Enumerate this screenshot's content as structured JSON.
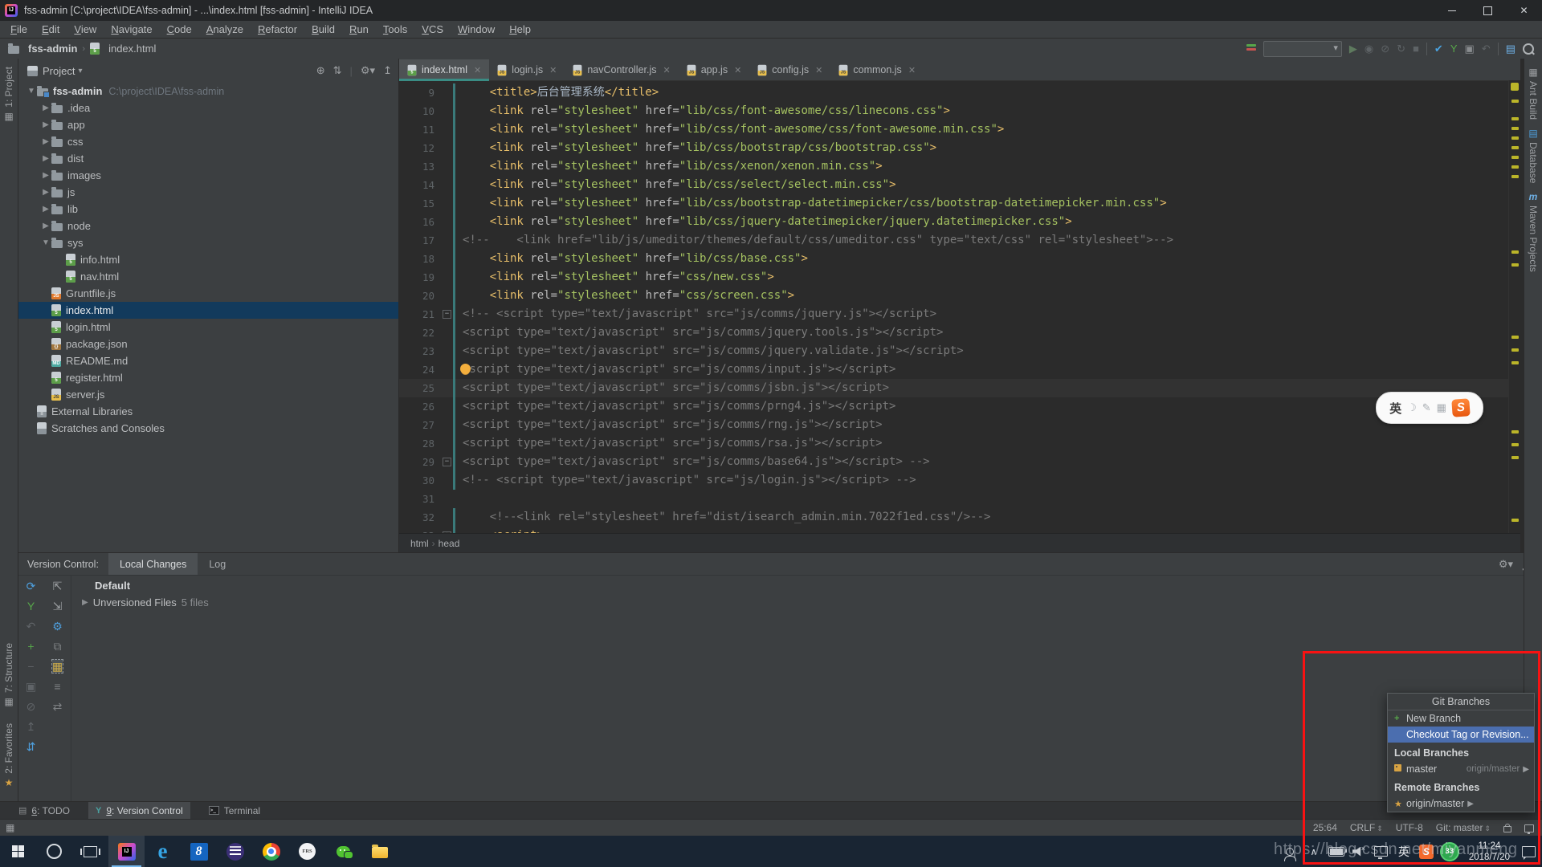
{
  "window": {
    "title": "fss-admin [C:\\project\\IDEA\\fss-admin] - ...\\index.html [fss-admin] - IntelliJ IDEA"
  },
  "menu": {
    "items": [
      "File",
      "Edit",
      "View",
      "Navigate",
      "Code",
      "Analyze",
      "Refactor",
      "Build",
      "Run",
      "Tools",
      "VCS",
      "Window",
      "Help"
    ]
  },
  "navbar": {
    "crumbs": [
      {
        "icon": "folder",
        "label": "fss-admin",
        "bold": true
      },
      {
        "icon": "file-html",
        "label": "index.html"
      }
    ]
  },
  "left_stripe": {
    "top": [
      {
        "icon": "grid",
        "label": "1: Project"
      }
    ],
    "bottom": [
      {
        "icon": "grid",
        "label": "7: Structure"
      },
      {
        "icon": "star",
        "label": "2: Favorites"
      }
    ]
  },
  "right_stripe": [
    {
      "icon": "ant",
      "label": "Ant Build"
    },
    {
      "icon": "db",
      "label": "Database"
    },
    {
      "icon": "maven",
      "label": "Maven Projects"
    }
  ],
  "project_panel": {
    "header": {
      "title": "Project",
      "icons": [
        "locate",
        "collapse-all",
        "separator",
        "settings",
        "hide"
      ]
    },
    "tree": [
      {
        "indent": 0,
        "arrow": "open",
        "icon": "project",
        "label": "fss-admin",
        "path": "C:\\project\\IDEA\\fss-admin",
        "bold": true
      },
      {
        "indent": 1,
        "arrow": "closed",
        "icon": "folder",
        "label": ".idea"
      },
      {
        "indent": 1,
        "arrow": "closed",
        "icon": "folder",
        "label": "app"
      },
      {
        "indent": 1,
        "arrow": "closed",
        "icon": "folder",
        "label": "css"
      },
      {
        "indent": 1,
        "arrow": "closed",
        "icon": "folder",
        "label": "dist"
      },
      {
        "indent": 1,
        "arrow": "closed",
        "icon": "folder",
        "label": "images"
      },
      {
        "indent": 1,
        "arrow": "closed",
        "icon": "folder",
        "label": "js"
      },
      {
        "indent": 1,
        "arrow": "closed",
        "icon": "folder",
        "label": "lib"
      },
      {
        "indent": 1,
        "arrow": "closed",
        "icon": "folder",
        "label": "node"
      },
      {
        "indent": 1,
        "arrow": "open",
        "icon": "folder",
        "label": "sys"
      },
      {
        "indent": 2,
        "icon": "file-html",
        "label": "info.html"
      },
      {
        "indent": 2,
        "icon": "file-html",
        "label": "nav.html"
      },
      {
        "indent": 1,
        "icon": "file-js-orange",
        "label": "Gruntfile.js"
      },
      {
        "indent": 1,
        "icon": "file-html",
        "label": "index.html",
        "selected": true
      },
      {
        "indent": 1,
        "icon": "file-html",
        "label": "login.html"
      },
      {
        "indent": 1,
        "icon": "file-json",
        "label": "package.json"
      },
      {
        "indent": 1,
        "icon": "file-md",
        "label": "README.md"
      },
      {
        "indent": 1,
        "icon": "file-html",
        "label": "register.html"
      },
      {
        "indent": 1,
        "icon": "file-js",
        "label": "server.js"
      },
      {
        "indent": 0,
        "icon": "lib",
        "label": "External Libraries"
      },
      {
        "indent": 0,
        "icon": "scratch",
        "label": "Scratches and Consoles"
      }
    ]
  },
  "editor": {
    "tabs": [
      {
        "icon": "file-html",
        "label": "index.html",
        "active": true
      },
      {
        "icon": "file-js",
        "label": "login.js"
      },
      {
        "icon": "file-js",
        "label": "navController.js"
      },
      {
        "icon": "file-js",
        "label": "app.js"
      },
      {
        "icon": "file-js",
        "label": "config.js"
      },
      {
        "icon": "file-js",
        "label": "common.js"
      }
    ],
    "breadcrumb": [
      "html",
      "head"
    ],
    "stripe_marks": [
      8,
      30,
      42,
      54,
      66,
      78,
      90,
      102,
      196,
      212,
      302,
      318,
      334,
      420,
      436,
      452,
      530
    ],
    "lines": [
      {
        "n": "9",
        "tokens": [
          [
            "t",
            "    "
          ],
          [
            "g",
            "<title>"
          ],
          [
            "p",
            "后台管理系统"
          ],
          [
            "g",
            "</title>"
          ]
        ]
      },
      {
        "n": "10",
        "tokens": [
          [
            "t",
            "    "
          ],
          [
            "g",
            "<link"
          ],
          [
            "a",
            " rel="
          ],
          [
            "s",
            "\"stylesheet\""
          ],
          [
            "a",
            " href="
          ],
          [
            "s",
            "\"lib/css/font-awesome/css/linecons.css\""
          ],
          [
            "g",
            ">"
          ]
        ]
      },
      {
        "n": "11",
        "tokens": [
          [
            "t",
            "    "
          ],
          [
            "g",
            "<link"
          ],
          [
            "a",
            " rel="
          ],
          [
            "s",
            "\"stylesheet\""
          ],
          [
            "a",
            " href="
          ],
          [
            "s",
            "\"lib/css/font-awesome/css/font-awesome.min.css\""
          ],
          [
            "g",
            ">"
          ]
        ]
      },
      {
        "n": "12",
        "tokens": [
          [
            "t",
            "    "
          ],
          [
            "g",
            "<link"
          ],
          [
            "a",
            " rel="
          ],
          [
            "s",
            "\"stylesheet\""
          ],
          [
            "a",
            " href="
          ],
          [
            "s",
            "\"lib/css/bootstrap/css/bootstrap.css\""
          ],
          [
            "g",
            ">"
          ]
        ]
      },
      {
        "n": "13",
        "tokens": [
          [
            "t",
            "    "
          ],
          [
            "g",
            "<link"
          ],
          [
            "a",
            " rel="
          ],
          [
            "s",
            "\"stylesheet\""
          ],
          [
            "a",
            " href="
          ],
          [
            "s",
            "\"lib/css/xenon/xenon.min.css\""
          ],
          [
            "g",
            ">"
          ]
        ]
      },
      {
        "n": "14",
        "tokens": [
          [
            "t",
            "    "
          ],
          [
            "g",
            "<link"
          ],
          [
            "a",
            " rel="
          ],
          [
            "s",
            "\"stylesheet\""
          ],
          [
            "a",
            " href="
          ],
          [
            "s",
            "\"lib/css/select/select.min.css\""
          ],
          [
            "g",
            ">"
          ]
        ]
      },
      {
        "n": "15",
        "tokens": [
          [
            "t",
            "    "
          ],
          [
            "g",
            "<link"
          ],
          [
            "a",
            " rel="
          ],
          [
            "s",
            "\"stylesheet\""
          ],
          [
            "a",
            " href="
          ],
          [
            "s",
            "\"lib/css/bootstrap-datetimepicker/css/bootstrap-datetimepicker.min.css\""
          ],
          [
            "g",
            ">"
          ]
        ]
      },
      {
        "n": "16",
        "tokens": [
          [
            "t",
            "    "
          ],
          [
            "g",
            "<link"
          ],
          [
            "a",
            " rel="
          ],
          [
            "s",
            "\"stylesheet\""
          ],
          [
            "a",
            " href="
          ],
          [
            "s",
            "\"lib/css/jquery-datetimepicker/jquery.datetimepicker.css\""
          ],
          [
            "g",
            ">"
          ]
        ]
      },
      {
        "n": "17",
        "tokens": [
          [
            "c",
            "<!--    <link href=\"lib/js/umeditor/themes/default/css/umeditor.css\" type=\"text/css\" rel=\"stylesheet\">-->"
          ]
        ]
      },
      {
        "n": "18",
        "tokens": [
          [
            "t",
            "    "
          ],
          [
            "g",
            "<link"
          ],
          [
            "a",
            " rel="
          ],
          [
            "s",
            "\"stylesheet\""
          ],
          [
            "a",
            " href="
          ],
          [
            "s",
            "\"lib/css/base.css\""
          ],
          [
            "g",
            ">"
          ]
        ]
      },
      {
        "n": "19",
        "tokens": [
          [
            "t",
            "    "
          ],
          [
            "g",
            "<link"
          ],
          [
            "a",
            " rel="
          ],
          [
            "s",
            "\"stylesheet\""
          ],
          [
            "a",
            " href="
          ],
          [
            "s",
            "\"css/new.css\""
          ],
          [
            "g",
            ">"
          ]
        ]
      },
      {
        "n": "20",
        "tokens": [
          [
            "t",
            "    "
          ],
          [
            "g",
            "<link"
          ],
          [
            "a",
            " rel="
          ],
          [
            "s",
            "\"stylesheet\""
          ],
          [
            "a",
            " href="
          ],
          [
            "s",
            "\"css/screen.css\""
          ],
          [
            "g",
            ">"
          ]
        ]
      },
      {
        "n": "21",
        "fold": "minus",
        "tokens": [
          [
            "c",
            "<!-- <script type=\"text/javascript\" src=\"js/comms/jquery.js\"></script>"
          ]
        ]
      },
      {
        "n": "22",
        "tokens": [
          [
            "c",
            "<script type=\"text/javascript\" src=\"js/comms/jquery.tools.js\"></script>"
          ]
        ]
      },
      {
        "n": "23",
        "tokens": [
          [
            "c",
            "<script type=\"text/javascript\" src=\"js/comms/jquery.validate.js\"></script>"
          ]
        ]
      },
      {
        "n": "24",
        "bulb": true,
        "tokens": [
          [
            "c",
            "<script type=\"text/javascript\" src=\"js/comms/input.js\"></script>"
          ]
        ]
      },
      {
        "n": "25",
        "current": true,
        "tokens": [
          [
            "c",
            "<script type=\"text/javascript\" src=\"js/comms/jsbn.js\"></script>"
          ]
        ]
      },
      {
        "n": "26",
        "tokens": [
          [
            "c",
            "<script type=\"text/javascript\" src=\"js/comms/prng4.js\"></script>"
          ]
        ]
      },
      {
        "n": "27",
        "tokens": [
          [
            "c",
            "<script type=\"text/javascript\" src=\"js/comms/rng.js\"></script>"
          ]
        ]
      },
      {
        "n": "28",
        "tokens": [
          [
            "c",
            "<script type=\"text/javascript\" src=\"js/comms/rsa.js\"></script>"
          ]
        ]
      },
      {
        "n": "29",
        "fold": "minus",
        "tokens": [
          [
            "c",
            "<script type=\"text/javascript\" src=\"js/comms/base64.js\"></script> -->"
          ]
        ]
      },
      {
        "n": "30",
        "tokens": [
          [
            "c",
            "<!-- <script type=\"text/javascript\" src=\"js/login.js\"></script> -->"
          ]
        ]
      },
      {
        "n": "31",
        "tokens": []
      },
      {
        "n": "32",
        "tokens": [
          [
            "t",
            "    "
          ],
          [
            "c",
            "<!--<link rel=\"stylesheet\" href=\"dist/isearch_admin.min.7022f1ed.css\"/>-->"
          ]
        ]
      },
      {
        "n": "33",
        "fold": "plus",
        "tokens": [
          [
            "t",
            "    "
          ],
          [
            "g",
            "<script>"
          ]
        ]
      }
    ]
  },
  "vcs_panel": {
    "title": "Version Control:",
    "tabs": [
      {
        "label": "Local Changes",
        "active": true
      },
      {
        "label": "Log"
      }
    ],
    "changelist": "Default",
    "unversioned": {
      "label": "Unversioned Files",
      "count": "5 files"
    },
    "toolbar_col1": [
      [
        "⟳",
        "#4E9FDD"
      ],
      [
        "Y",
        "#57A64A"
      ],
      [
        "↶",
        "#606468"
      ],
      [
        "+",
        "#57A64A"
      ],
      [
        "−",
        "#606468"
      ],
      [
        "▣",
        "#606468"
      ],
      [
        "⊘",
        "#606468"
      ],
      [
        "↥",
        "#606468"
      ],
      [
        "⇵",
        "#4E9FDD"
      ]
    ],
    "toolbar_col2": [
      [
        "⇱",
        "#9DA0A3"
      ],
      [
        "⇲",
        "#9DA0A3"
      ],
      [
        "⚙",
        "#4E9FDD"
      ],
      [
        "⧉",
        "#7E8184"
      ],
      [
        "▦",
        "#C8A94A"
      ],
      [
        "≡",
        "#7E8184"
      ],
      [
        "⇄",
        "#7E8184"
      ]
    ]
  },
  "bottom_bar": [
    {
      "icon": "todo",
      "num": "6",
      "label": ": TODO"
    },
    {
      "icon": "vcs",
      "num": "9",
      "label": ": Version Control",
      "active": true
    },
    {
      "icon": "terminal",
      "num": "",
      "label": "Terminal"
    }
  ],
  "status_bar": {
    "position": "25:64",
    "line_ending": "CRLF",
    "encoding": "UTF-8",
    "git_branch": "Git: master"
  },
  "git_popup": {
    "title": "Git Branches",
    "items": [
      {
        "type": "action",
        "icon": "plus",
        "label": "New Branch"
      },
      {
        "type": "action",
        "label": "Checkout Tag or Revision...",
        "selected": true
      },
      {
        "type": "header",
        "label": "Local Branches"
      },
      {
        "type": "branch",
        "icon": "tag",
        "label": "master",
        "right": "origin/master",
        "arrow": true
      },
      {
        "type": "header",
        "label": "Remote Branches"
      },
      {
        "type": "branch",
        "icon": "star",
        "label": "origin/master",
        "arrow": true
      }
    ]
  },
  "taskbar": {
    "apps": [
      {
        "name": "start"
      },
      {
        "name": "cortana"
      },
      {
        "name": "task-view"
      },
      {
        "name": "intellij",
        "active": true
      },
      {
        "name": "edge",
        "glyph": "e"
      },
      {
        "name": "app-8",
        "glyph": "8"
      },
      {
        "name": "eclipse"
      },
      {
        "name": "chrome"
      },
      {
        "name": "frs",
        "label": "FRS"
      },
      {
        "name": "wechat"
      },
      {
        "name": "explorer"
      }
    ],
    "tray": {
      "ime_indicator": "英",
      "badge_count": "33",
      "clock_time": "11:24",
      "clock_date": "2018/7/20"
    }
  },
  "sogou_pill": {
    "ime_letter": "英",
    "icons": [
      "☽",
      "✎",
      "▦"
    ],
    "logo_letter": "S"
  },
  "watermark": {
    "text": "https://blog.csdn.net/miyanmeng"
  },
  "colors": {
    "accent_selection": "#4B6EAF",
    "annotation": "#F81212",
    "tab_underline": "#3A8C84",
    "change_bar": "#3A7A7A",
    "warning_mark": "#BBB529"
  }
}
